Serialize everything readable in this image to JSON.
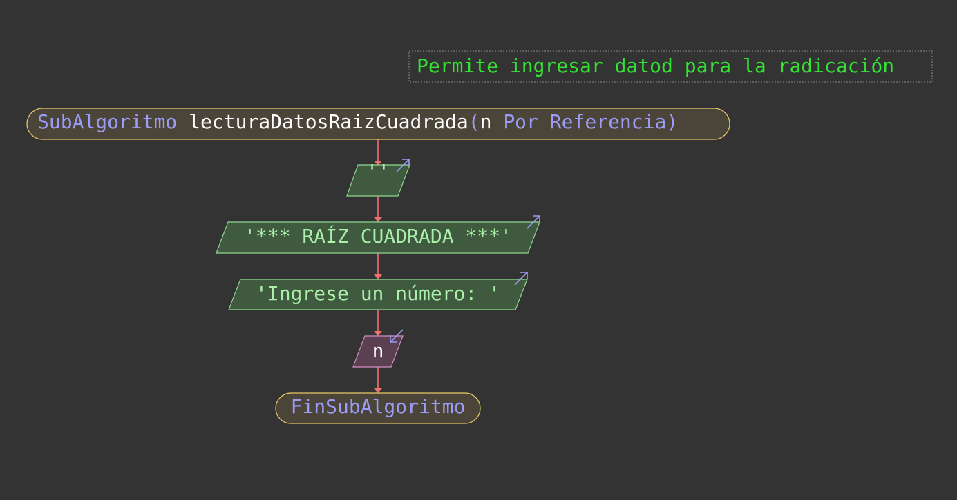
{
  "comment": "Permite ingresar datod para la radicación",
  "header": {
    "keyword": "SubAlgoritmo",
    "name": "lecturaDatosRaizCuadrada",
    "open_paren": "(",
    "param": "n",
    "param_modifier": "Por Referencia",
    "close_paren": ")"
  },
  "steps": [
    {
      "type": "output",
      "text": "''"
    },
    {
      "type": "output",
      "text": "'*** RAÍZ CUADRADA ***'"
    },
    {
      "type": "output",
      "text": "'Ingrese un número: '"
    },
    {
      "type": "input",
      "text": "n"
    }
  ],
  "footer": {
    "keyword": "FinSubAlgoritmo"
  },
  "colors": {
    "background": "#333333",
    "keyword": "#9c9cf8",
    "identifier": "#ffffff",
    "string": "#aaf0aa",
    "comment": "#34e234",
    "edge": "#f07070",
    "terminal_border": "#e8c66a",
    "output_fill": "#3f5a3f",
    "input_fill": "#5a4050"
  }
}
